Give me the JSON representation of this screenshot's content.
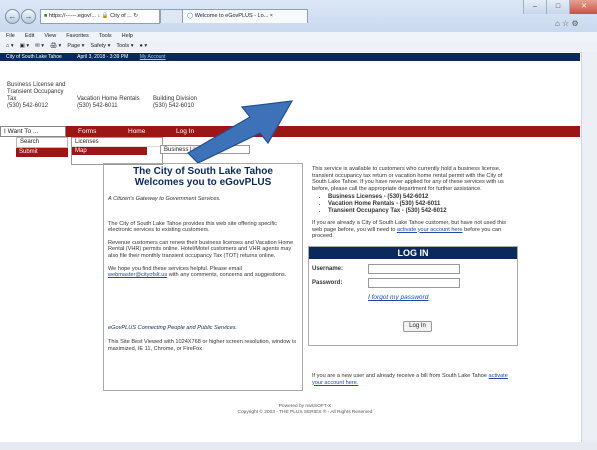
{
  "browser": {
    "address": "https://------.egov/...",
    "address_suffix": "↓ 🔒 City of ... ↻",
    "tab_active": "Welcome to eGovPLUS - Lo...",
    "tab_close": "×",
    "menu": [
      "File",
      "Edit",
      "View",
      "Favorites",
      "Tools",
      "Help"
    ],
    "commands": [
      "⌂ ▾",
      "▣ ▾",
      "✉ ▾",
      "🖨 ▾",
      "Page ▾",
      "Safety ▾",
      "Tools ▾",
      "● ▾"
    ]
  },
  "site_strip": {
    "city": "City of South Lake Tahoe",
    "datetime": "April 3, 2018 - 3:39 PM",
    "account_link": "My Account"
  },
  "header": {
    "col1": [
      "Business License and",
      "Transient Occupancy",
      "Tax",
      "(530) 542-6012"
    ],
    "col2": [
      "Vacation Home Rentals",
      "(530) 542-6011"
    ],
    "col3": [
      "Building Division",
      "(530) 542-6010"
    ]
  },
  "nav": {
    "i_want_to": "I Want To ...",
    "items": [
      "Forms",
      "Home",
      "Log In"
    ],
    "left_menu": [
      "Search",
      "Submit"
    ],
    "forms_dropdown": [
      "Licenses",
      "Map"
    ],
    "licenses_submenu": [
      "Business License"
    ]
  },
  "welcome": {
    "line1": "The City of South Lake Tahoe",
    "line2": "Welcomes you to eGovPLUS",
    "tagline": "A Citizen's Gateway to Government Services.",
    "para1": "The City of South Lake Tahoe provides this web site offering specific electronic services to existing customers.",
    "para2": "Revenue customers can renew their business licenses and Vacation Home Rental (VHR) permits online. Hotel/Motel customers and VHR agents may also file their monthly transient occupancy Tax (TOT) returns online.",
    "para3_pre": "We hope you find these services helpful. Please email",
    "email": "webmaster@cityofslt.us",
    "para3_post": "with any comments, concerns and suggestions.",
    "brand_line": "eGovPLUS Connecting People and Public Services.",
    "best_viewed": "This Site Best Viewed with 1024X768 or higher screen resolution, window is maximized, IE 11, Chrome, or FireFox"
  },
  "info": {
    "para1": "This service is available to customers who currently hold a business license, transient occupancy tax return or vacation home rental permit with the City of South Lake Tahoe. If you have never applied for any of these services with us before, please call the appropriate department for further assistance.",
    "bullets": [
      "Business Licenses - (530) 542-6012",
      "Vacation Home Rentals - (530) 542-6011",
      "Transient Occupancy Tax - (530) 542-6012"
    ],
    "para2_pre": "If you are already a City of South Lake Tahoe customer, but have not used this web page before, you will need to",
    "activate_link": "activate your account here",
    "para2_post": "before you can proceed."
  },
  "login": {
    "title": "LOG IN",
    "username_label": "Username:",
    "password_label": "Password:",
    "forgot": "I forgot my password",
    "button": "Log In",
    "footer_pre": "If you are a new user and already receive a bill from South Lake Tahoe",
    "footer_link": "activate your account here."
  },
  "footer": {
    "line1": "Powered by nwsSOFT-X",
    "line2": "Copyright © 2003 - THE PLUS SERIES ® - All Rights Reserved"
  },
  "colors": {
    "nav_red": "#9c1616",
    "navy": "#0b2a5b",
    "arrow_blue": "#3d72b8"
  }
}
